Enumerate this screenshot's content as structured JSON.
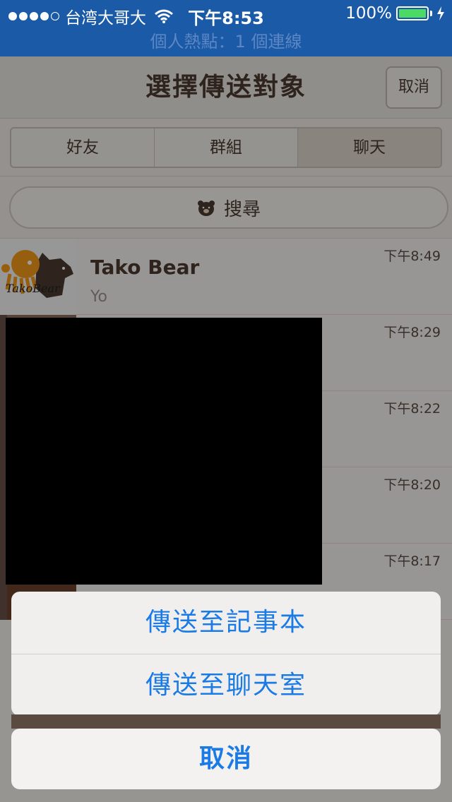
{
  "status_bar": {
    "carrier": "台湾大哥大",
    "time": "下午8:53",
    "battery": "100%"
  },
  "hotspot_banner": "個人熱點：1 個連線",
  "nav": {
    "title": "選擇傳送對象",
    "cancel": "取消"
  },
  "tabs": [
    {
      "label": "好友"
    },
    {
      "label": "群組"
    },
    {
      "label": "聊天",
      "selected": true
    }
  ],
  "search": {
    "label": "搜尋"
  },
  "chats": [
    {
      "name": "Tako Bear",
      "message": "Yo",
      "time": "下午8:49"
    },
    {
      "name": "",
      "message": "",
      "time": "下午8:29"
    },
    {
      "name": "",
      "message": "",
      "time": "下午8:22"
    },
    {
      "name": "",
      "message": "",
      "time": "下午8:20"
    },
    {
      "name": "",
      "message": "",
      "time": "下午8:17"
    }
  ],
  "action_sheet": {
    "items": [
      "傳送至記事本",
      "傳送至聊天室"
    ],
    "cancel": "取消"
  },
  "colors": {
    "status_bar": "#1a5aa7",
    "action_text": "#1a7ae6",
    "battery": "#4cd964"
  }
}
